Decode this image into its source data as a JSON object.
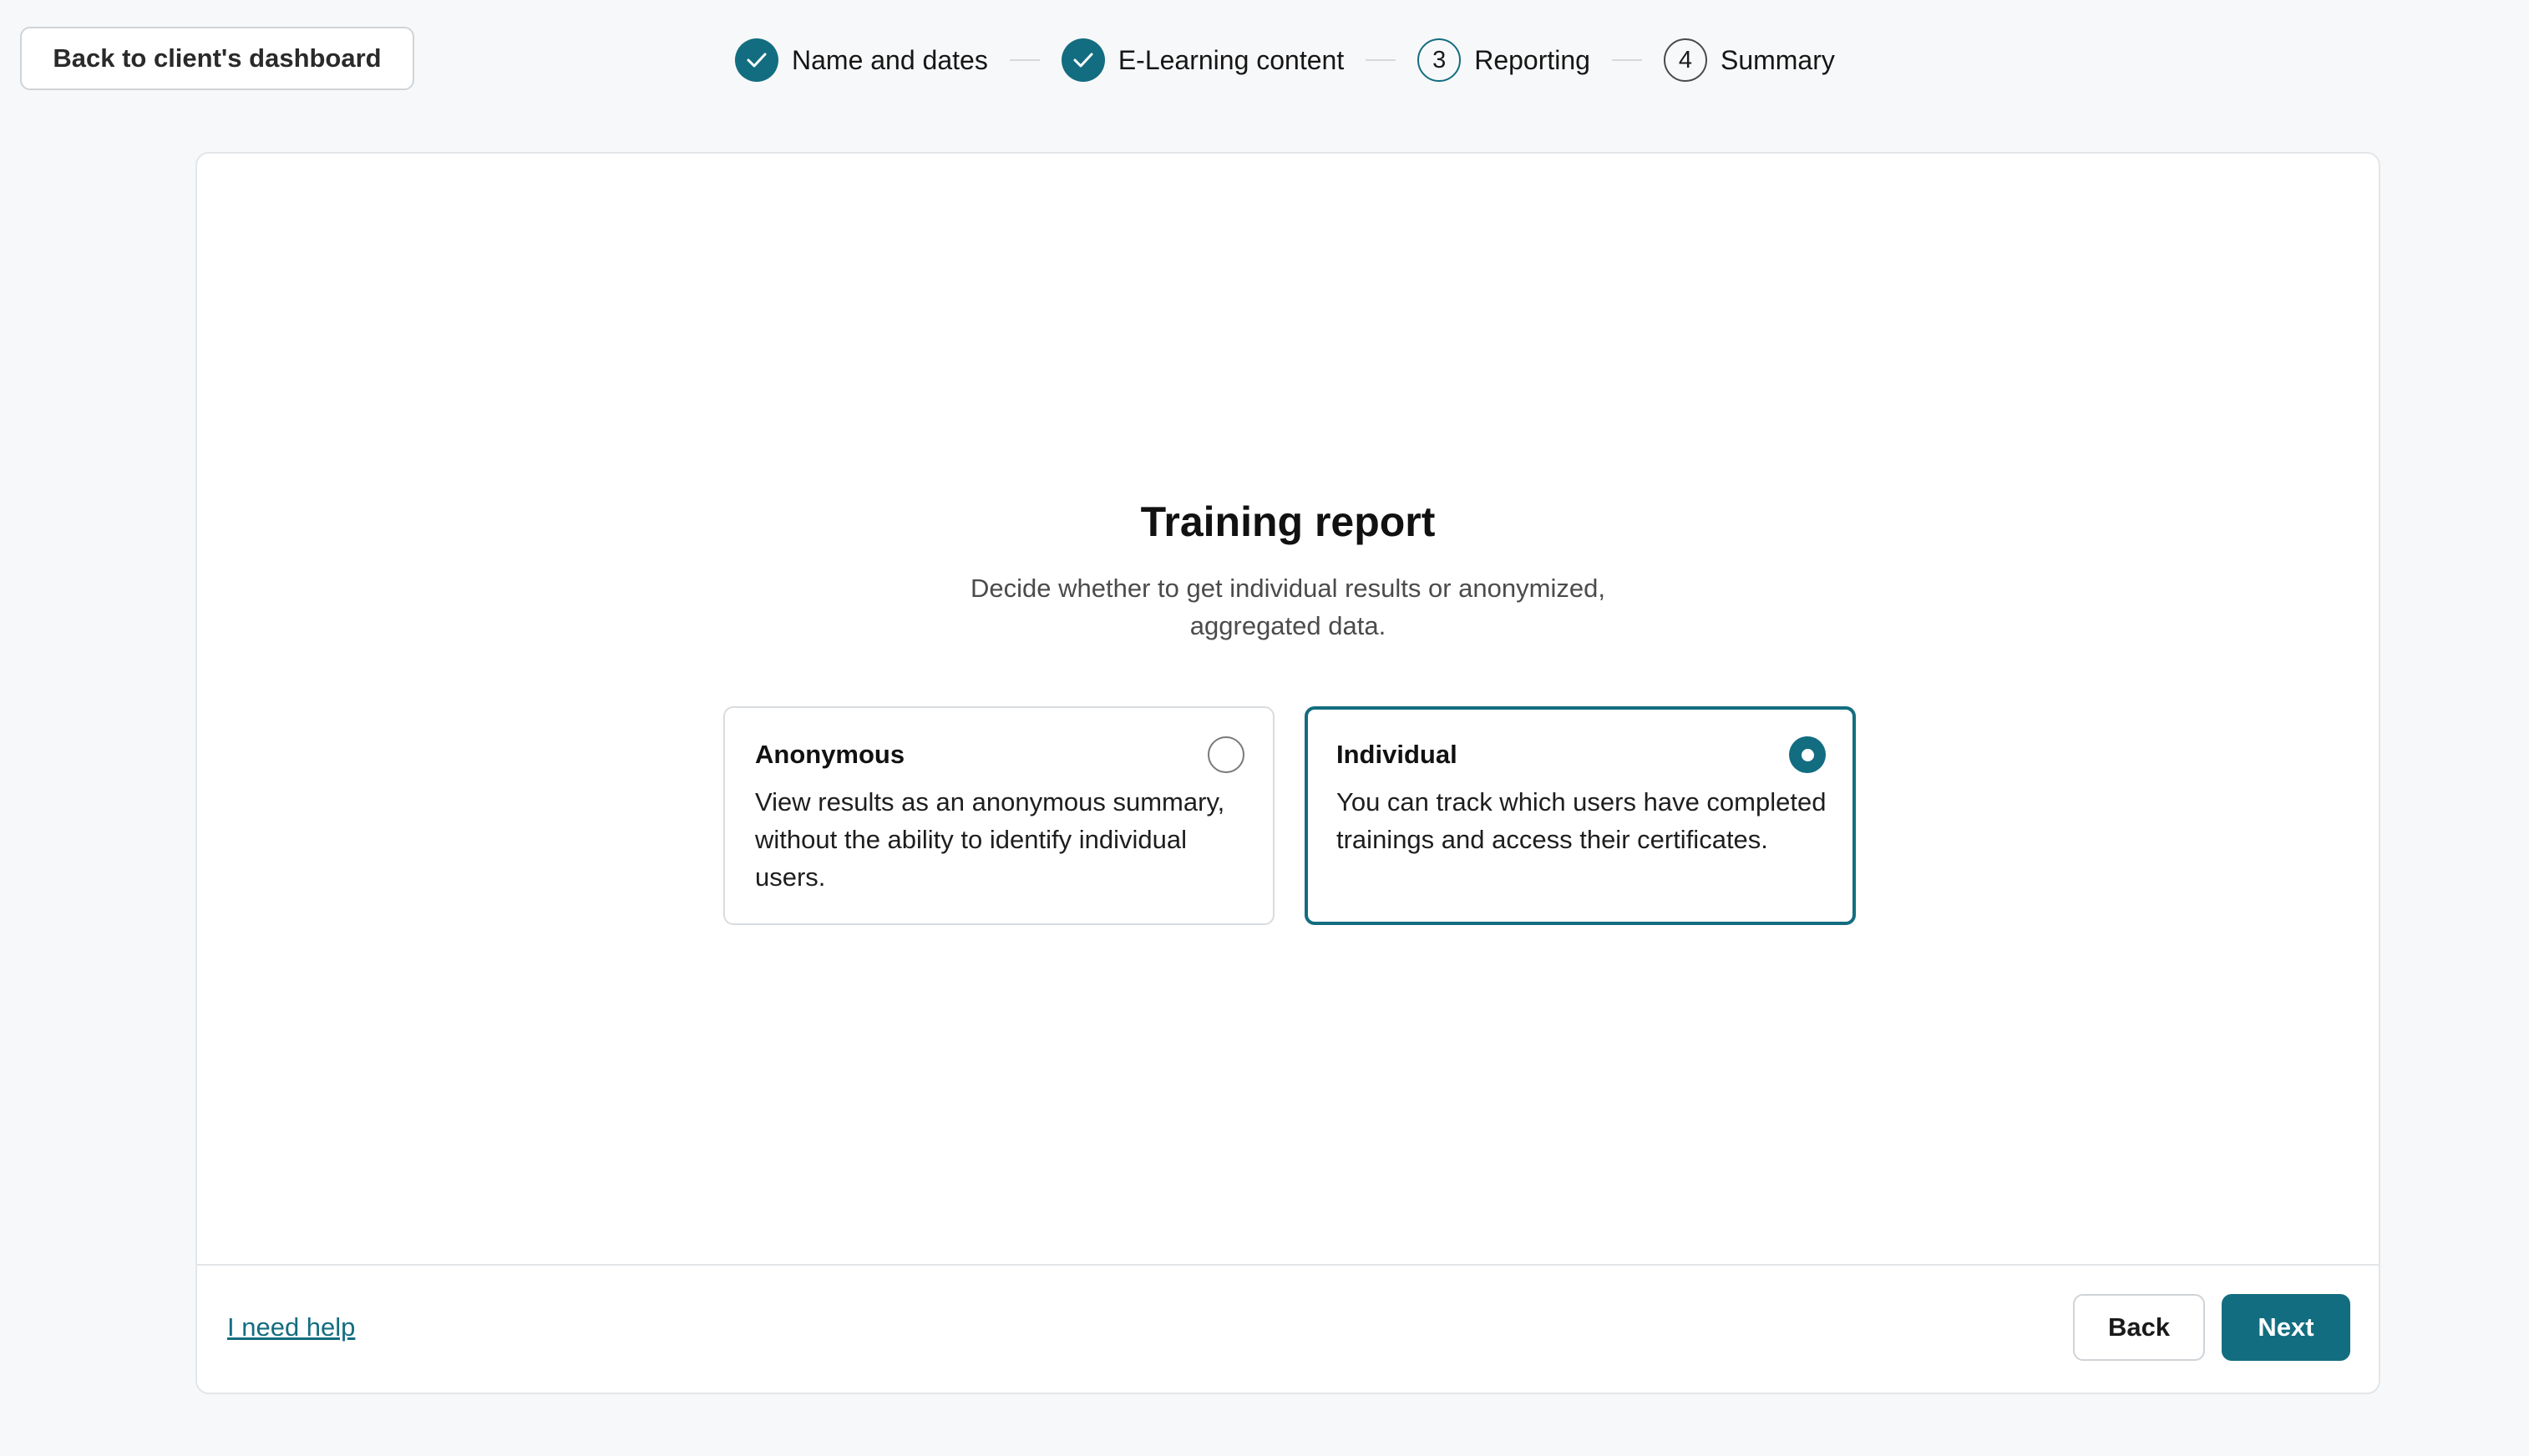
{
  "header": {
    "back_button_label": "Back to client's dashboard"
  },
  "stepper": {
    "steps": [
      {
        "label": "Name and dates",
        "status": "done",
        "number": "",
        "icon": "check-icon"
      },
      {
        "label": "E-Learning content",
        "status": "done",
        "number": "",
        "icon": "check-icon"
      },
      {
        "label": "Reporting",
        "status": "current",
        "number": "3"
      },
      {
        "label": "Summary",
        "status": "todo",
        "number": "4"
      }
    ]
  },
  "main": {
    "title": "Training report",
    "subtitle": "Decide whether to get individual results or anonymized, aggregated data.",
    "options": [
      {
        "title": "Anonymous",
        "description": "View results as an anonymous summary, without the ability to identify individual users.",
        "selected": false
      },
      {
        "title": "Individual",
        "description": "You can track which users have completed trainings and access their certificates.",
        "selected": true
      }
    ]
  },
  "footer": {
    "help_link": "I need help",
    "back_label": "Back",
    "next_label": "Next"
  },
  "colors": {
    "accent": "#136d80",
    "background": "#f7f8f9",
    "card": "#ffffff",
    "border": "#e3e6e8"
  }
}
